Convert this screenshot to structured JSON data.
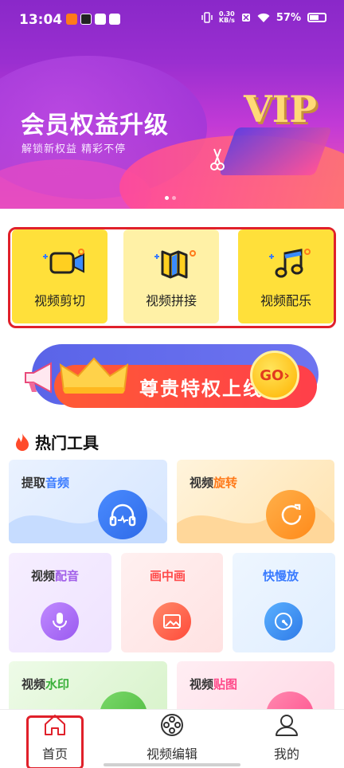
{
  "status": {
    "time": "13:04",
    "speed_value": "0.30",
    "speed_unit": "KB/s",
    "battery": "57%"
  },
  "banner": {
    "title": "会员权益升级",
    "subtitle": "解锁新权益 精彩不停",
    "badge": "VIP",
    "slide_count": 2,
    "active_slide": 1
  },
  "features": [
    {
      "label": "视频剪切",
      "icon": "video-camera-icon"
    },
    {
      "label": "视频拼接",
      "icon": "map-fold-icon"
    },
    {
      "label": "视频配乐",
      "icon": "music-note-icon"
    }
  ],
  "promo": {
    "text": "尊贵特权上线",
    "go": "GO"
  },
  "hot_tools": {
    "title": "热门工具",
    "items": [
      {
        "label_a": "提取",
        "label_b": "音频",
        "icon": "headphones-icon"
      },
      {
        "label_a": "视频",
        "label_b": "旋转",
        "icon": "rotate-icon"
      },
      {
        "label_a": "视频",
        "label_b": "配音",
        "icon": "microphone-icon"
      },
      {
        "label_a": "画中画",
        "label_b": "",
        "icon": "picture-icon"
      },
      {
        "label_a": "快慢放",
        "label_b": "",
        "icon": "speed-dial-icon"
      },
      {
        "label_a": "视频",
        "label_b": "水印",
        "icon": "camera-icon"
      },
      {
        "label_a": "视频",
        "label_b": "贴图",
        "icon": "image-icon"
      }
    ]
  },
  "nav": {
    "items": [
      {
        "label": "首页",
        "icon": "home-icon"
      },
      {
        "label": "视频编辑",
        "icon": "film-reel-icon"
      },
      {
        "label": "我的",
        "icon": "user-icon"
      }
    ],
    "active": "首页"
  },
  "colors": {
    "accent_red": "#e0202a",
    "tile_yellow": "#ffe03a",
    "tile_pale": "#fff1a6",
    "title_blue": "#3a7bff"
  }
}
